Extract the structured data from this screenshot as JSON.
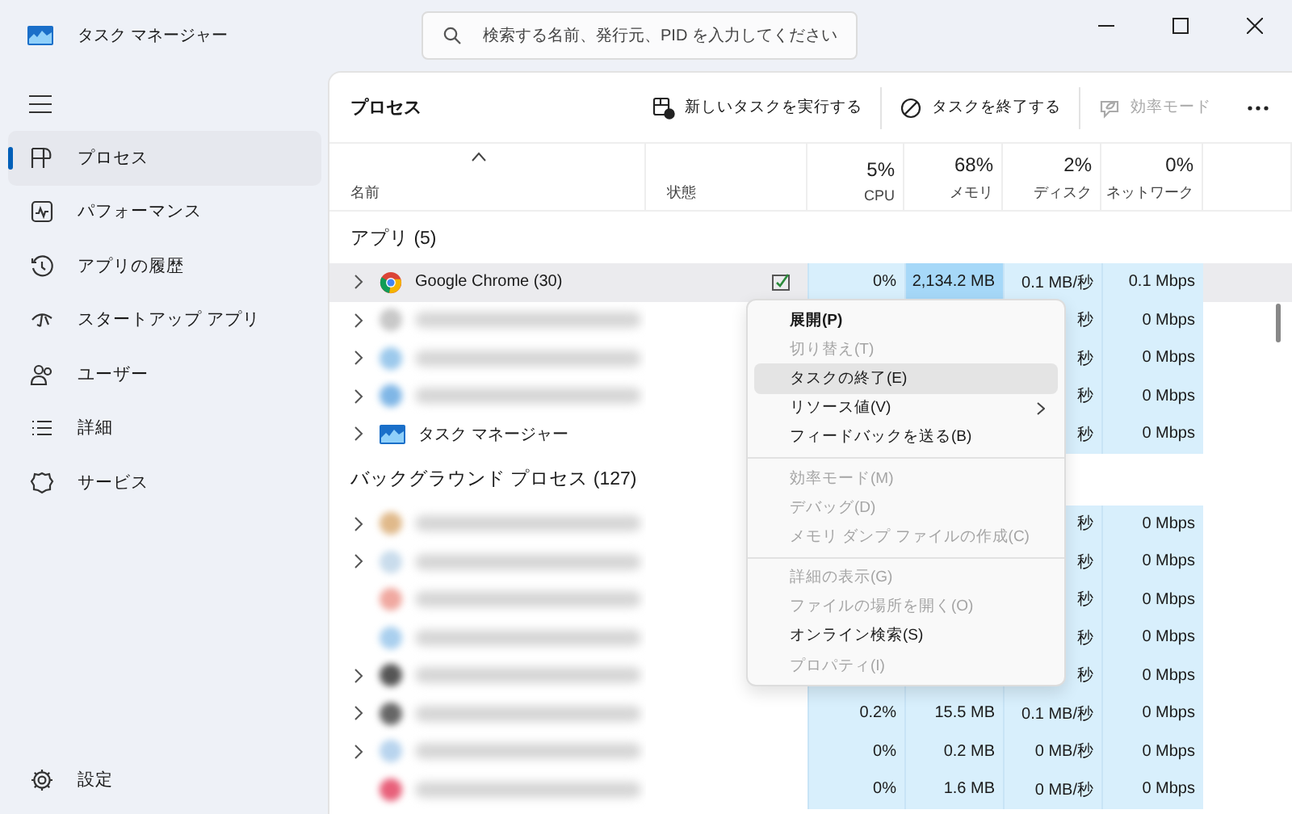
{
  "window": {
    "title": "タスク マネージャー"
  },
  "search": {
    "placeholder": "検索する名前、発行元、PID を入力してください"
  },
  "sidebar": {
    "items": [
      {
        "label": "プロセス",
        "selected": true
      },
      {
        "label": "パフォーマンス",
        "selected": false
      },
      {
        "label": "アプリの履歴",
        "selected": false
      },
      {
        "label": "スタートアップ アプリ",
        "selected": false
      },
      {
        "label": "ユーザー",
        "selected": false
      },
      {
        "label": "詳細",
        "selected": false
      },
      {
        "label": "サービス",
        "selected": false
      }
    ],
    "settings": "設定"
  },
  "toolbar": {
    "title": "プロセス",
    "buttons": [
      {
        "label": "新しいタスクを実行する",
        "disabled": false
      },
      {
        "label": "タスクを終了する",
        "disabled": false
      },
      {
        "label": "効率モード",
        "disabled": true
      }
    ]
  },
  "table": {
    "columns": [
      {
        "label": "名前"
      },
      {
        "label": "状態"
      },
      {
        "label": "CPU",
        "total": "5%"
      },
      {
        "label": "メモリ",
        "total": "68%"
      },
      {
        "label": "ディスク",
        "total": "2%"
      },
      {
        "label": "ネットワーク",
        "total": "0%"
      }
    ],
    "groups": [
      {
        "title": "アプリ (5)",
        "rows": [
          {
            "name": "Google Chrome (30)",
            "blurred": false,
            "expandable": true,
            "kind": "browser",
            "hovered": true,
            "status_icon": true,
            "cpu": "0%",
            "memory": "2,134.2 MB",
            "memory_highlighted": true,
            "disk": "0.1 MB/秒",
            "network": "0.1 Mbps"
          },
          {
            "blurred": true,
            "expandable": true,
            "kind": "blurred",
            "color": "#c8c8c8",
            "hovered": false,
            "status_icon": false,
            "memory_highlighted": false,
            "disk": "秒",
            "network": "0 Mbps"
          },
          {
            "blurred": true,
            "expandable": true,
            "kind": "blurred",
            "color": "#9cc9ec",
            "hovered": false,
            "status_icon": false,
            "memory_highlighted": false,
            "disk": "秒",
            "network": "0 Mbps"
          },
          {
            "blurred": true,
            "expandable": true,
            "kind": "blurred",
            "color": "#7fb6e6",
            "hovered": false,
            "status_icon": false,
            "memory_highlighted": false,
            "disk": "秒",
            "network": "0 Mbps"
          },
          {
            "name": "タスク マネージャー",
            "blurred": false,
            "expandable": true,
            "kind": "taskmgr",
            "hovered": false,
            "status_icon": false,
            "memory_highlighted": false,
            "disk": "秒",
            "network": "0 Mbps"
          }
        ]
      },
      {
        "title": "バックグラウンド プロセス (127)",
        "rows": [
          {
            "blurred": true,
            "expandable": true,
            "kind": "blurred",
            "color": "#e0b98a",
            "hovered": false,
            "status_icon": false,
            "memory_highlighted": false,
            "disk": "秒",
            "network": "0 Mbps"
          },
          {
            "blurred": true,
            "expandable": true,
            "kind": "blurred",
            "color": "#c9dcec",
            "hovered": false,
            "status_icon": false,
            "memory_highlighted": false,
            "disk": "秒",
            "network": "0 Mbps"
          },
          {
            "blurred": true,
            "expandable": false,
            "kind": "blurred",
            "color": "#f0a8a0",
            "hovered": false,
            "status_icon": false,
            "memory_highlighted": false,
            "disk": "秒",
            "network": "0 Mbps"
          },
          {
            "blurred": true,
            "expandable": false,
            "kind": "blurred",
            "color": "#a9cfee",
            "hovered": false,
            "status_icon": false,
            "memory_highlighted": false,
            "disk": "秒",
            "network": "0 Mbps"
          },
          {
            "blurred": true,
            "expandable": true,
            "kind": "blurred",
            "color": "#555555",
            "hovered": false,
            "status_icon": false,
            "memory_highlighted": false,
            "disk": "秒",
            "network": "0 Mbps"
          },
          {
            "blurred": true,
            "expandable": true,
            "kind": "blurred",
            "color": "#666666",
            "hovered": false,
            "status_icon": false,
            "memory_highlighted": false,
            "cpu": "0.2%",
            "memory": "15.5 MB",
            "disk": "0.1 MB/秒",
            "network": "0 Mbps"
          },
          {
            "blurred": true,
            "expandable": true,
            "kind": "blurred",
            "color": "#b8d4ee",
            "hovered": false,
            "status_icon": false,
            "memory_highlighted": false,
            "cpu": "0%",
            "memory": "0.2 MB",
            "disk": "0 MB/秒",
            "network": "0 Mbps"
          },
          {
            "blurred": true,
            "expandable": false,
            "kind": "blurred",
            "color": "#e8607a",
            "hovered": false,
            "status_icon": false,
            "memory_highlighted": false,
            "cpu": "0%",
            "memory": "1.6 MB",
            "disk": "0 MB/秒",
            "network": "0 Mbps"
          }
        ]
      }
    ]
  },
  "context_menu": {
    "items": [
      {
        "kind": "item",
        "label": "展開(P)",
        "bold": true,
        "disabled": false,
        "hovered": false
      },
      {
        "kind": "item",
        "label": "切り替え(T)",
        "disabled": true,
        "hovered": false
      },
      {
        "kind": "item",
        "label": "タスクの終了(E)",
        "disabled": false,
        "hovered": true
      },
      {
        "kind": "item",
        "label": "リソース値(V)",
        "disabled": false,
        "hovered": false,
        "submenu": true
      },
      {
        "kind": "item",
        "label": "フィードバックを送る(B)",
        "disabled": false,
        "hovered": false
      },
      {
        "kind": "separator"
      },
      {
        "kind": "item",
        "label": "効率モード(M)",
        "disabled": true,
        "hovered": false
      },
      {
        "kind": "item",
        "label": "デバッグ(D)",
        "disabled": true,
        "hovered": false
      },
      {
        "kind": "item",
        "label": "メモリ ダンプ ファイルの作成(C)",
        "disabled": true,
        "hovered": false
      },
      {
        "kind": "separator"
      },
      {
        "kind": "item",
        "label": "詳細の表示(G)",
        "disabled": true,
        "hovered": false
      },
      {
        "kind": "item",
        "label": "ファイルの場所を開く(O)",
        "disabled": true,
        "hovered": false
      },
      {
        "kind": "item",
        "label": "オンライン検索(S)",
        "disabled": false,
        "hovered": false
      },
      {
        "kind": "item",
        "label": "プロパティ(I)",
        "disabled": true,
        "hovered": false
      }
    ]
  }
}
